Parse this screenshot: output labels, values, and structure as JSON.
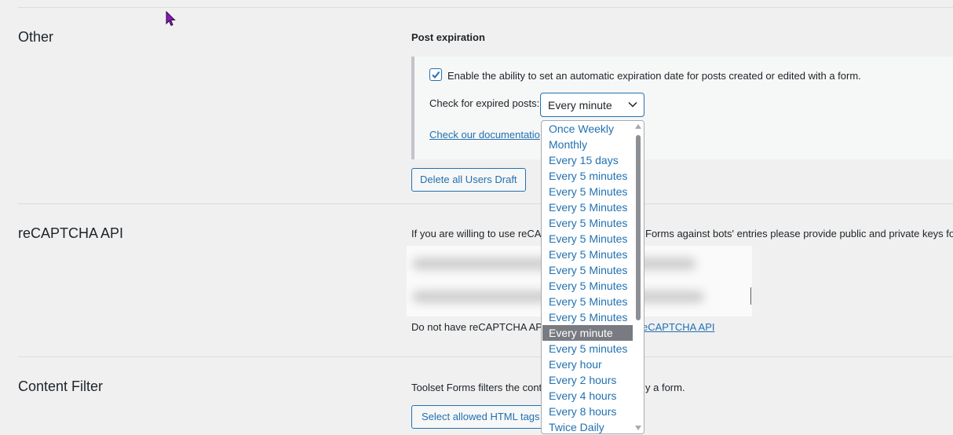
{
  "sections": {
    "other": "Other",
    "recaptcha": "reCAPTCHA API",
    "content_filter": "Content Filter"
  },
  "post_expiration": {
    "heading": "Post expiration",
    "enable_label": "Enable the ability to set an automatic expiration date for posts created or edited with a form.",
    "enabled": true,
    "check_label": "Check for expired posts:",
    "selected_value": "Every minute",
    "doc_link": "Check our documentatio",
    "options": [
      "Once Weekly",
      "Monthly",
      "Every 15 days",
      "Every 5 minutes",
      "Every 5 Minutes",
      "Every 5 Minutes",
      "Every 5 Minutes",
      "Every 5 Minutes",
      "Every 5 Minutes",
      "Every 5 Minutes",
      "Every 5 Minutes",
      "Every 5 Minutes",
      "Every 5 Minutes",
      "Every minute",
      "Every 5 minutes",
      "Every hour",
      "Every 2 hours",
      "Every 4 hours",
      "Every 8 hours",
      "Twice Daily"
    ],
    "highlighted_index": 13
  },
  "delete_drafts_button": "Delete all Users Draft",
  "recaptcha": {
    "description_start": "If you are willing to use reCA",
    "description_end": "Forms against bots' entries please provide public and private keys fo",
    "no_key_text": "Do not have reCAPTCHA API",
    "key_link": "eCAPTCHA API"
  },
  "content_filter": {
    "description_start": "Toolset Forms filters the cont",
    "description_end": "y a form.",
    "button": "Select allowed HTML tags"
  },
  "colors": {
    "accent": "#2271b1",
    "background": "#f0f0f1",
    "highlight": "#787c82"
  }
}
